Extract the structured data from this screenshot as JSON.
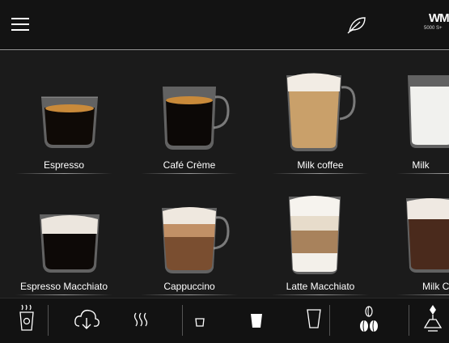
{
  "header": {
    "menu_icon": "hamburger-menu-icon",
    "eco_icon": "leaf-icon",
    "brand_logo": "WMF",
    "brand_model": "5000 S+"
  },
  "beverages": [
    {
      "label": "Espresso",
      "icon": "espresso-glass"
    },
    {
      "label": "Café Crème",
      "icon": "cafe-creme-glass"
    },
    {
      "label": "Milk coffee",
      "icon": "milk-coffee-glass"
    },
    {
      "label": "Milk",
      "icon": "milk-glass"
    },
    {
      "label": "Espresso Macchiato",
      "icon": "espresso-macchiato-glass"
    },
    {
      "label": "Cappuccino",
      "icon": "cappuccino-glass"
    },
    {
      "label": "Latte Macchiato",
      "icon": "latte-macchiato-glass"
    },
    {
      "label": "Milk Ch",
      "icon": "milk-choc-glass"
    }
  ],
  "bottom_bar": [
    {
      "name": "hot-water-cup-icon"
    },
    {
      "name": "cloud-download-icon"
    },
    {
      "name": "steam-icon"
    },
    {
      "name": "small-cup-icon"
    },
    {
      "name": "medium-cup-icon"
    },
    {
      "name": "large-cup-icon"
    },
    {
      "name": "coffee-beans-icon"
    },
    {
      "name": "grinder-icon"
    }
  ]
}
